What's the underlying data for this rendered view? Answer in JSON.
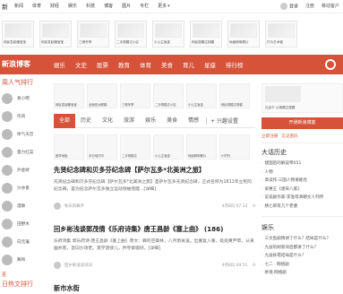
{
  "topnav": {
    "logo": "新",
    "links": [
      "新闻",
      "体育",
      "财经",
      "娱乐",
      "科技",
      "博客",
      "图片",
      "专栏",
      "更多"
    ],
    "right": [
      "登录",
      "注册",
      "移动客户"
    ]
  },
  "ads_top": [
    "网民发起暖宝宝",
    "网民发起暖宝宝",
    "三精冬季",
    "二手规模达小区",
    "小公主盲盒",
    "网民规模达规模",
    "地面精明看片",
    "打为艺术营"
  ],
  "channel_bar": {
    "site": "新浪博客",
    "channels": [
      "娱乐",
      "文史",
      "股票",
      "教育",
      "体育",
      "美食",
      "育儿",
      "星座",
      "排行榜"
    ]
  },
  "left": {
    "heading": "周人气排行",
    "users": [
      "易小明",
      "作风",
      "体气天宫",
      "量力红菜",
      "外金财",
      "沙亦香",
      "漫聊",
      "田野木",
      "向元藩",
      "舞和"
    ],
    "footer": "更",
    "heading2": "日热文排行"
  },
  "row_thumbs": [
    "网民发起暖宝宝",
    "全面亚洲规模",
    "三精冬季",
    "二手规模达小区",
    "小公主盲盒",
    "网民规模达规模"
  ],
  "sub_tabs": {
    "items": [
      "全部",
      "历史",
      "文化",
      "旅游",
      "娱乐",
      "美食",
      "情感"
    ],
    "settings": "+ 兴趣设置"
  },
  "thumbs2": [
    "团学地板",
    "本日地打印",
    "二手规模达",
    "小公主盲盒",
    "地面精明看片",
    "小时刊"
  ],
  "articles": [
    {
      "title": "先贤纪念碑和贝多芬纪念碑【萨尔瓦多*北美洲之旅】",
      "summary": "先贤纪念碑和贝多芬纪念碑【萨尔瓦多*北美洲之旅】圣萨尔瓦多先贤纪念碑，正式名称为1811年立宪的纪念碑，是为纪念萨尔瓦多独立运动领袖而建...[详细]",
      "author": "秋天的枫叶",
      "date": "4月8日 07:33",
      "comments": "0"
    },
    {
      "title": "回乡彬浅谈郭茂倩《乐府诗集》唐王昌龄《塞上曲》 (186)",
      "summary": "乐府诗集 郭乐府诗·唐王昌龄《塞上曲》原文：蝉鸣空桑林，八月萧关道。出塞复入塞，处处黄芦草。从来幽并客，皆向沙场老。莫学游侠儿，矜夸紫骝好。[详细]",
      "author": "回乡彬浅谈诗词",
      "date": "4月8日 09:51",
      "comments": "0"
    },
    {
      "title": "新市水街",
      "summary": "",
      "author": "",
      "date": "",
      "comments": ""
    }
  ],
  "right": {
    "ad_caption": "礼品卡 以规模达规模",
    "button": "开通新浪博客",
    "links": [
      "立即注册",
      "忘记密码"
    ],
    "history_heading": "大话历史",
    "history_items": [
      "建国后的解说帝451",
      "人物",
      "简谈作·三国人物诸葛亮",
      "梁惠王《唐宋八家》",
      "说说剧作家·李渔等清朝文人列传",
      "杨七郎有几个老婆"
    ],
    "ent_heading": "娱乐",
    "ent_items": [
      "三文鱼剧情讲了什么？结局是什么？",
      "九层的刷新背后都讲了什么？",
      "九层妖塔结局是什么？",
      "七二 · 网络剧",
      "绝境·网络剧"
    ]
  },
  "colors": {
    "accent": "#d6533a"
  }
}
